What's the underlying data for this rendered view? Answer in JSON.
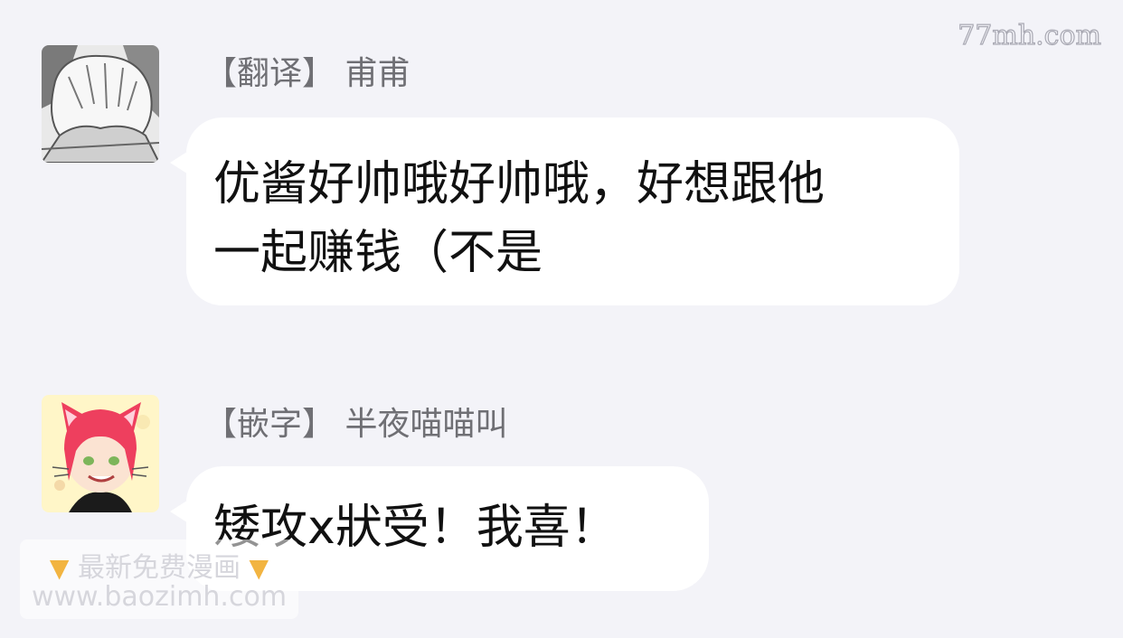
{
  "watermark": {
    "site": "77mh.com"
  },
  "messages": [
    {
      "role": "【翻译】",
      "name": "甫甫",
      "text_lines": [
        "优酱好帅哦好帅哦，好想跟他",
        "一起赚钱（不是"
      ]
    },
    {
      "role": "【嵌字】",
      "name": "半夜喵喵叫",
      "text_lines": [
        "矮攻x狀受！我喜！"
      ]
    }
  ],
  "promo": {
    "title": "最新免费漫画",
    "url": "www.baozimh.com",
    "icon": "pointing-down-emoji"
  },
  "colors": {
    "background": "#f3f3f8",
    "bubble": "#ffffff",
    "sender_text": "#6f6f74",
    "message_text": "#111111",
    "avatar2_hair": "#ee3f5e"
  }
}
